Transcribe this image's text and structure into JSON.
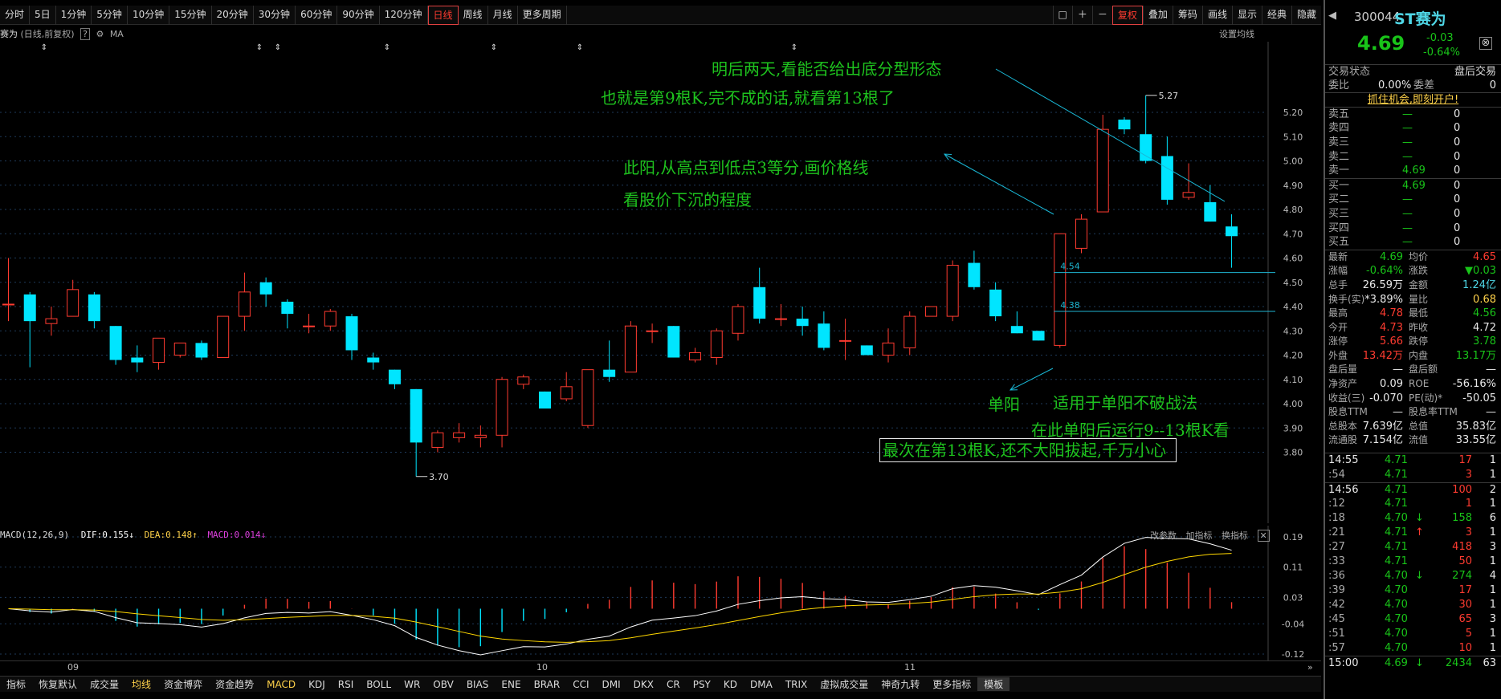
{
  "toolbar": {
    "periods": [
      "分时",
      "5日",
      "1分钟",
      "5分钟",
      "10分钟",
      "15分钟",
      "20分钟",
      "30分钟",
      "60分钟",
      "90分钟",
      "120分钟",
      "日线",
      "周线",
      "月线",
      "更多周期"
    ],
    "active_period": "日线",
    "tools": [
      "复权",
      "叠加",
      "筹码",
      "画线",
      "显示",
      "经典",
      "隐藏"
    ]
  },
  "chart_header": {
    "name": "赛为",
    "mode": "(日线,前复权)",
    "help": "?",
    "ma": "MA",
    "set_ma": "设置均线"
  },
  "price_axis": [
    "5.20",
    "5.10",
    "5.00",
    "4.90",
    "4.80",
    "4.70",
    "4.60",
    "4.50",
    "4.40",
    "4.30",
    "4.20",
    "4.10",
    "4.00",
    "3.90",
    "3.80"
  ],
  "price_markers": {
    "high": "5.27",
    "low": "3.70",
    "line1": "4.54",
    "line2": "4.38"
  },
  "notes": {
    "n1": "明后两天,看能否给出底分型形态",
    "n2": "也就是第9根K,完不成的话,就看第13根了",
    "n3": "此阳,从高点到低点3等分,画价格线",
    "n4": "看股价下沉的程度",
    "n5": "单阳",
    "n6": "适用于单阳不破战法",
    "n7": "在此单阳后运行9--13根K看",
    "n8": "最次在第13根K,还不大阳拔起,千万小心"
  },
  "macd": {
    "title": "MACD(12,26,9)",
    "dif": "DIF:0.155",
    "dea": "DEA:0.148",
    "macd": "MACD:0.014",
    "buttons": [
      "改参数",
      "加指标",
      "换指标"
    ],
    "axis": [
      "0.19",
      "0.11",
      "0.03",
      "-0.04",
      "-0.12"
    ]
  },
  "dates": [
    "09",
    "10",
    "11"
  ],
  "indicator_tabs": [
    "指标",
    "恢复默认",
    "成交量",
    "均线",
    "资金博弈",
    "资金趋势",
    "MACD",
    "KDJ",
    "RSI",
    "BOLL",
    "WR",
    "OBV",
    "BIAS",
    "ENE",
    "BRAR",
    "CCI",
    "DMI",
    "DKX",
    "CR",
    "PSY",
    "KD",
    "DMA",
    "TRIX",
    "虚拟成交量",
    "神奇九转",
    "更多指标",
    "模板"
  ],
  "stock": {
    "code": "300044",
    "name": "ST赛为",
    "price": "4.69",
    "change": "-0.03",
    "change_pct": "-0.64%"
  },
  "trade_state": {
    "label": "交易状态",
    "value": "盘后交易"
  },
  "weibi": {
    "label": "委比",
    "value": "0.00%",
    "label2": "委差",
    "value2": "0"
  },
  "promo": "抓住机会,即刻开户!",
  "asks": [
    {
      "l": "卖五",
      "p": "—",
      "v": "0"
    },
    {
      "l": "卖四",
      "p": "—",
      "v": "0"
    },
    {
      "l": "卖三",
      "p": "—",
      "v": "0"
    },
    {
      "l": "卖二",
      "p": "—",
      "v": "0"
    },
    {
      "l": "卖一",
      "p": "4.69",
      "v": "0"
    }
  ],
  "bids": [
    {
      "l": "买一",
      "p": "4.69",
      "v": "0"
    },
    {
      "l": "买二",
      "p": "—",
      "v": "0"
    },
    {
      "l": "买三",
      "p": "—",
      "v": "0"
    },
    {
      "l": "买四",
      "p": "—",
      "v": "0"
    },
    {
      "l": "买五",
      "p": "—",
      "v": "0"
    }
  ],
  "stats": [
    {
      "a": "最新",
      "b": "4.69",
      "bc": "g",
      "c": "均价",
      "d": "4.65",
      "dc": "r"
    },
    {
      "a": "涨幅",
      "b": "-0.64%",
      "bc": "g",
      "c": "涨跌",
      "d": "▼0.03",
      "dc": "g"
    },
    {
      "a": "总手",
      "b": "26.59万",
      "bc": "w",
      "c": "金额",
      "d": "1.24亿",
      "dc": "c"
    },
    {
      "a": "换手(实)",
      "b": "*3.89%",
      "bc": "w",
      "c": "量比",
      "d": "0.68",
      "dc": "y"
    },
    {
      "a": "最高",
      "b": "4.78",
      "bc": "r",
      "c": "最低",
      "d": "4.56",
      "dc": "g"
    },
    {
      "a": "今开",
      "b": "4.73",
      "bc": "r",
      "c": "昨收",
      "d": "4.72",
      "dc": "w"
    },
    {
      "a": "涨停",
      "b": "5.66",
      "bc": "r",
      "c": "跌停",
      "d": "3.78",
      "dc": "g"
    },
    {
      "a": "外盘",
      "b": "13.42万",
      "bc": "r",
      "c": "内盘",
      "d": "13.17万",
      "dc": "g"
    },
    {
      "a": "盘后量",
      "b": "—",
      "bc": "w",
      "c": "盘后额",
      "d": "—",
      "dc": "w"
    },
    {
      "a": "净资产",
      "b": "0.09",
      "bc": "w",
      "c": "ROE",
      "d": "-56.16%",
      "dc": "w"
    },
    {
      "a": "收益(三)",
      "b": "-0.070",
      "bc": "w",
      "c": "PE(动)*",
      "d": "-50.05",
      "dc": "w"
    },
    {
      "a": "股息TTM",
      "b": "—",
      "bc": "w",
      "c": "股息率TTM",
      "d": "—",
      "dc": "w"
    },
    {
      "a": "总股本",
      "b": "7.639亿",
      "bc": "w",
      "c": "总值",
      "d": "35.83亿",
      "dc": "w"
    },
    {
      "a": "流通股",
      "b": "7.154亿",
      "bc": "w",
      "c": "流值",
      "d": "33.55亿",
      "dc": "w"
    }
  ],
  "ticks": [
    {
      "t": "14:55",
      "p": "4.71",
      "v": "17",
      "n": "1",
      "vc": "r",
      "arrow": ""
    },
    {
      "t": ":54",
      "p": "4.71",
      "v": "3",
      "n": "1",
      "vc": "r",
      "arrow": ""
    },
    {
      "t": "14:56",
      "p": "4.71",
      "v": "100",
      "n": "2",
      "vc": "r",
      "arrow": ""
    },
    {
      "t": ":12",
      "p": "4.71",
      "v": "1",
      "n": "1",
      "vc": "r",
      "arrow": ""
    },
    {
      "t": ":18",
      "p": "4.70",
      "v": "158",
      "n": "6",
      "vc": "g",
      "arrow": "↓"
    },
    {
      "t": ":21",
      "p": "4.71",
      "v": "3",
      "n": "1",
      "vc": "r",
      "arrow": "↑"
    },
    {
      "t": ":27",
      "p": "4.71",
      "v": "418",
      "n": "3",
      "vc": "r",
      "arrow": ""
    },
    {
      "t": ":33",
      "p": "4.71",
      "v": "50",
      "n": "1",
      "vc": "r",
      "arrow": ""
    },
    {
      "t": ":36",
      "p": "4.70",
      "v": "274",
      "n": "4",
      "vc": "g",
      "arrow": "↓"
    },
    {
      "t": ":39",
      "p": "4.70",
      "v": "17",
      "n": "1",
      "vc": "r",
      "arrow": ""
    },
    {
      "t": ":42",
      "p": "4.70",
      "v": "30",
      "n": "1",
      "vc": "r",
      "arrow": ""
    },
    {
      "t": ":45",
      "p": "4.70",
      "v": "65",
      "n": "3",
      "vc": "r",
      "arrow": ""
    },
    {
      "t": ":51",
      "p": "4.70",
      "v": "5",
      "n": "1",
      "vc": "r",
      "arrow": ""
    },
    {
      "t": ":57",
      "p": "4.70",
      "v": "10",
      "n": "1",
      "vc": "r",
      "arrow": ""
    },
    {
      "t": "15:00",
      "p": "4.69",
      "v": "2434",
      "n": "63",
      "vc": "g",
      "arrow": "↓"
    }
  ],
  "colors": {
    "up": "#ff3b30",
    "down": "#00e5ff",
    "dif": "#ffffff",
    "dea": "#ffd700",
    "grid": "#1e3a5a",
    "arrow": "#19b8d6"
  },
  "chart_data": {
    "type": "candlestick",
    "price_range": [
      3.7,
      5.27
    ],
    "candles": [
      {
        "o": 4.41,
        "c": 4.41,
        "h": 4.6,
        "l": 4.34
      },
      {
        "o": 4.45,
        "c": 4.34,
        "h": 4.46,
        "l": 4.15
      },
      {
        "o": 4.33,
        "c": 4.35,
        "h": 4.4,
        "l": 4.28
      },
      {
        "o": 4.36,
        "c": 4.47,
        "h": 4.51,
        "l": 4.36
      },
      {
        "o": 4.45,
        "c": 4.34,
        "h": 4.46,
        "l": 4.31
      },
      {
        "o": 4.32,
        "c": 4.18,
        "h": 4.32,
        "l": 4.16
      },
      {
        "o": 4.19,
        "c": 4.17,
        "h": 4.24,
        "l": 4.13
      },
      {
        "o": 4.17,
        "c": 4.27,
        "h": 4.27,
        "l": 4.14
      },
      {
        "o": 4.2,
        "c": 4.25,
        "h": 4.25,
        "l": 4.19
      },
      {
        "o": 4.25,
        "c": 4.19,
        "h": 4.26,
        "l": 4.18
      },
      {
        "o": 4.19,
        "c": 4.36,
        "h": 4.36,
        "l": 4.19
      },
      {
        "o": 4.36,
        "c": 4.46,
        "h": 4.54,
        "l": 4.3
      },
      {
        "o": 4.5,
        "c": 4.45,
        "h": 4.52,
        "l": 4.4
      },
      {
        "o": 4.42,
        "c": 4.37,
        "h": 4.43,
        "l": 4.31
      },
      {
        "o": 4.32,
        "c": 4.32,
        "h": 4.37,
        "l": 4.29
      },
      {
        "o": 4.32,
        "c": 4.38,
        "h": 4.39,
        "l": 4.3
      },
      {
        "o": 4.36,
        "c": 4.22,
        "h": 4.37,
        "l": 4.18
      },
      {
        "o": 4.19,
        "c": 4.17,
        "h": 4.21,
        "l": 4.14
      },
      {
        "o": 4.14,
        "c": 4.08,
        "h": 4.14,
        "l": 4.06
      },
      {
        "o": 4.06,
        "c": 3.84,
        "h": 4.06,
        "l": 3.7
      },
      {
        "o": 3.82,
        "c": 3.88,
        "h": 3.89,
        "l": 3.8
      },
      {
        "o": 3.86,
        "c": 3.88,
        "h": 3.92,
        "l": 3.84
      },
      {
        "o": 3.86,
        "c": 3.87,
        "h": 3.91,
        "l": 3.82
      },
      {
        "o": 3.87,
        "c": 4.1,
        "h": 4.11,
        "l": 3.82
      },
      {
        "o": 4.08,
        "c": 4.11,
        "h": 4.12,
        "l": 4.06
      },
      {
        "o": 4.05,
        "c": 3.98,
        "h": 4.05,
        "l": 3.98
      },
      {
        "o": 4.02,
        "c": 4.07,
        "h": 4.13,
        "l": 4.01
      },
      {
        "o": 3.91,
        "c": 4.14,
        "h": 4.14,
        "l": 3.9
      },
      {
        "o": 4.14,
        "c": 4.11,
        "h": 4.26,
        "l": 4.09
      },
      {
        "o": 4.13,
        "c": 4.32,
        "h": 4.34,
        "l": 4.13
      },
      {
        "o": 4.3,
        "c": 4.3,
        "h": 4.33,
        "l": 4.25
      },
      {
        "o": 4.32,
        "c": 4.19,
        "h": 4.32,
        "l": 4.19
      },
      {
        "o": 4.18,
        "c": 4.21,
        "h": 4.23,
        "l": 4.17
      },
      {
        "o": 4.19,
        "c": 4.3,
        "h": 4.31,
        "l": 4.16
      },
      {
        "o": 4.29,
        "c": 4.4,
        "h": 4.41,
        "l": 4.26
      },
      {
        "o": 4.48,
        "c": 4.35,
        "h": 4.56,
        "l": 4.33
      },
      {
        "o": 4.35,
        "c": 4.35,
        "h": 4.41,
        "l": 4.32
      },
      {
        "o": 4.35,
        "c": 4.32,
        "h": 4.4,
        "l": 4.28
      },
      {
        "o": 4.33,
        "c": 4.23,
        "h": 4.38,
        "l": 4.22
      },
      {
        "o": 4.26,
        "c": 4.26,
        "h": 4.35,
        "l": 4.18
      },
      {
        "o": 4.24,
        "c": 4.2,
        "h": 4.24,
        "l": 4.2
      },
      {
        "o": 4.2,
        "c": 4.25,
        "h": 4.31,
        "l": 4.17
      },
      {
        "o": 4.23,
        "c": 4.36,
        "h": 4.38,
        "l": 4.2
      },
      {
        "o": 4.36,
        "c": 4.4,
        "h": 4.4,
        "l": 4.36
      },
      {
        "o": 4.36,
        "c": 4.57,
        "h": 4.59,
        "l": 4.34
      },
      {
        "o": 4.58,
        "c": 4.48,
        "h": 4.63,
        "l": 4.47
      },
      {
        "o": 4.47,
        "c": 4.36,
        "h": 4.5,
        "l": 4.34
      },
      {
        "o": 4.32,
        "c": 4.29,
        "h": 4.38,
        "l": 4.29
      },
      {
        "o": 4.3,
        "c": 4.26,
        "h": 4.3,
        "l": 4.26
      },
      {
        "o": 4.24,
        "c": 4.7,
        "h": 4.7,
        "l": 4.23
      },
      {
        "o": 4.64,
        "c": 4.76,
        "h": 4.78,
        "l": 4.62
      },
      {
        "o": 4.79,
        "c": 5.13,
        "h": 5.19,
        "l": 4.8
      },
      {
        "o": 5.17,
        "c": 5.13,
        "h": 5.18,
        "l": 5.11
      },
      {
        "o": 5.11,
        "c": 5.0,
        "h": 5.27,
        "l": 4.99
      },
      {
        "o": 5.02,
        "c": 4.84,
        "h": 5.1,
        "l": 4.82
      },
      {
        "o": 4.85,
        "c": 4.87,
        "h": 4.99,
        "l": 4.84
      },
      {
        "o": 4.83,
        "c": 4.75,
        "h": 4.9,
        "l": 4.75
      },
      {
        "o": 4.73,
        "c": 4.69,
        "h": 4.78,
        "l": 4.56
      }
    ],
    "macd_axis": [
      -0.12,
      0.19
    ]
  }
}
